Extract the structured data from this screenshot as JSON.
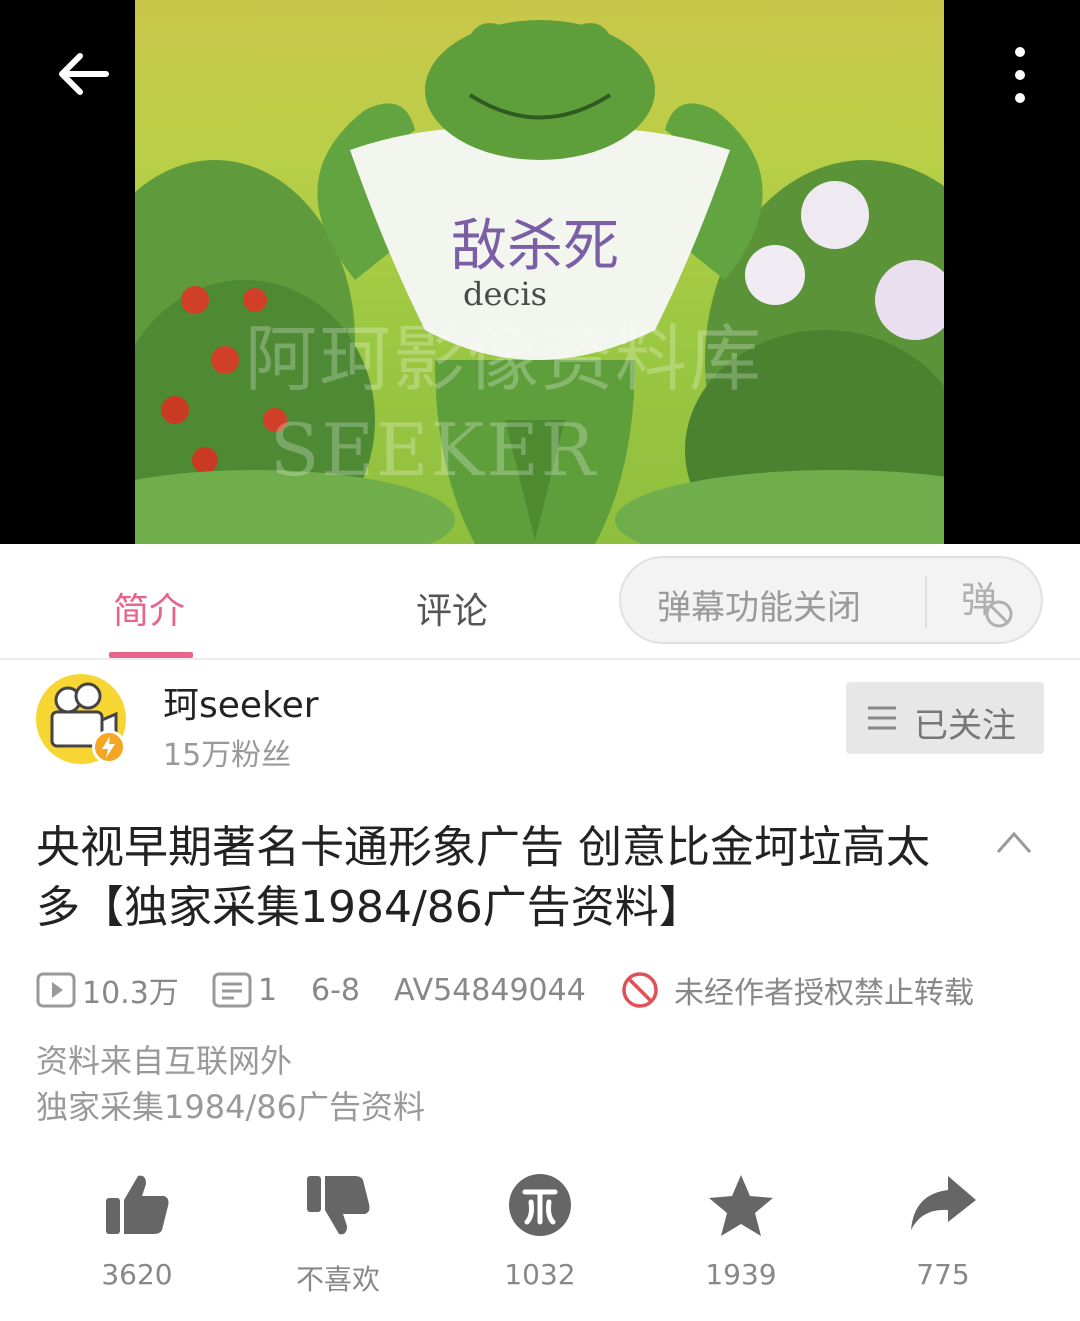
{
  "video": {
    "shirt_text": "敌杀死",
    "shirt_subtext": "decis",
    "watermark_line1": "阿珂影像资料库",
    "watermark_line2": "SEEKER"
  },
  "tabs": [
    {
      "label": "简介",
      "active": true
    },
    {
      "label": "评论",
      "active": false
    }
  ],
  "danmaku": {
    "label": "弹幕功能关闭"
  },
  "uploader": {
    "name": "珂seeker",
    "followers": "15万粉丝",
    "follow_label": "已关注"
  },
  "video_title": "央视早期著名卡通形象广告 创意比金坷垃高太多【独家采集1984/86广告资料】",
  "stats": {
    "views": "10.3万",
    "danmaku_count": "1",
    "date": "6-8",
    "av_id": "AV54849044",
    "repost_notice": "未经作者授权禁止转载"
  },
  "description": [
    "资料来自互联网外",
    "独家采集1984/86广告资料"
  ],
  "actions": [
    {
      "icon": "thumbs-up-icon",
      "label": "3620"
    },
    {
      "icon": "thumbs-down-icon",
      "label": "不喜欢"
    },
    {
      "icon": "coin-icon",
      "label": "1032"
    },
    {
      "icon": "star-icon",
      "label": "1939"
    },
    {
      "icon": "share-icon",
      "label": "775"
    }
  ],
  "colors": {
    "accent": "#e8648c",
    "notice_red": "#e0505a"
  }
}
